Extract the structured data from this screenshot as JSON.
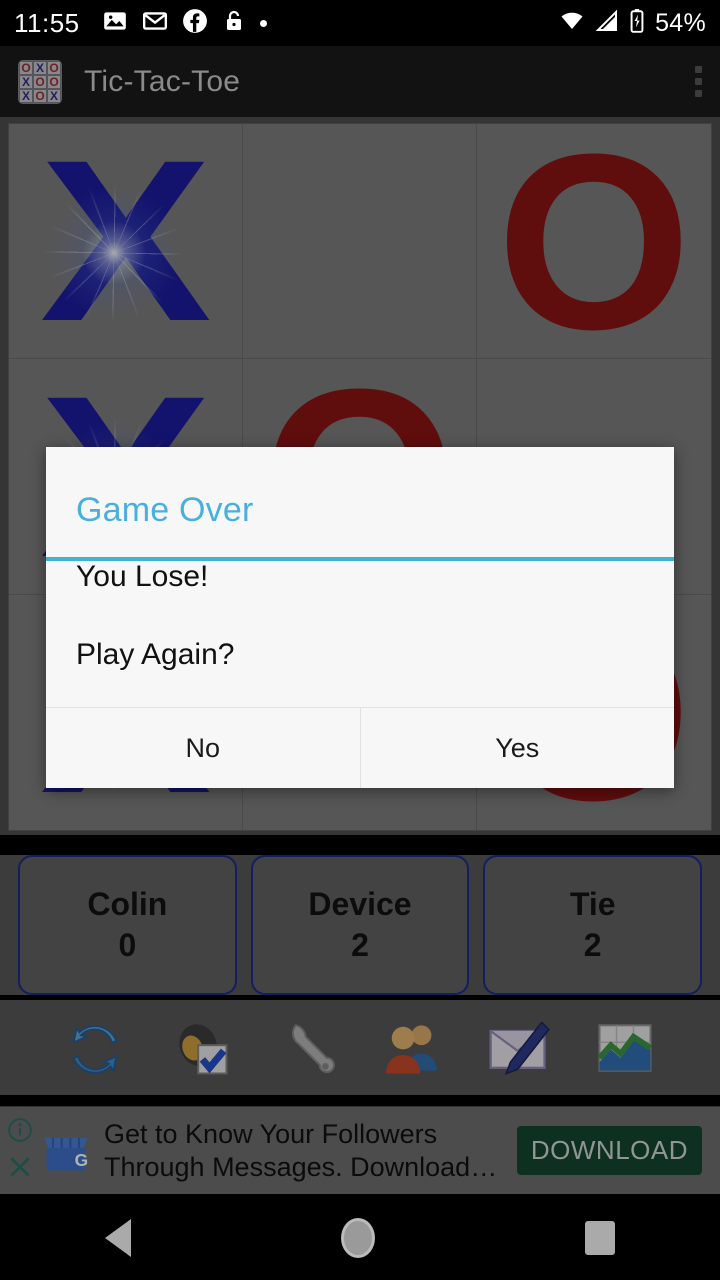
{
  "status_bar": {
    "time": "11:55",
    "battery_percent": "54%",
    "icons_left": [
      "photos-icon",
      "gmail-icon",
      "facebook-icon",
      "unlock-icon",
      "dot-indicator-icon"
    ],
    "icons_right": [
      "wifi-icon",
      "cell-signal-icon",
      "battery-charging-icon"
    ]
  },
  "app_bar": {
    "title": "Tic-Tac-Toe",
    "app_icon": "tic-tac-toe-grid-icon",
    "app_icon_cells": [
      "O",
      "X",
      "O",
      "X",
      "O",
      "O",
      "X",
      "O",
      "X"
    ],
    "overflow_icon": "more-vertical-icon"
  },
  "board": {
    "cells": [
      "X",
      "",
      "O",
      "X",
      "O",
      "",
      "X",
      "",
      "O"
    ],
    "x_color": "#1c1c9c",
    "o_color": "#8a1313",
    "cell_bg": "#7c7c7c",
    "highlight_cells": [
      0,
      3,
      6
    ]
  },
  "scores": [
    {
      "name": "Colin",
      "value": "0"
    },
    {
      "name": "Device",
      "value": "2"
    },
    {
      "name": "Tie",
      "value": "2"
    }
  ],
  "toolbar": {
    "items": [
      {
        "icon": "refresh-restart-icon",
        "label": "New Game"
      },
      {
        "icon": "sound-settings-icon",
        "label": "Sound"
      },
      {
        "icon": "wrench-settings-icon",
        "label": "Settings"
      },
      {
        "icon": "two-players-icon",
        "label": "Players"
      },
      {
        "icon": "email-compose-icon",
        "label": "Feedback"
      },
      {
        "icon": "statistics-chart-icon",
        "label": "Statistics"
      }
    ]
  },
  "ad": {
    "info_icon": "info-circle-icon",
    "close_icon": "close-x-icon",
    "brand_icon": "google-my-business-icon",
    "line1": "Get to Know Your Followers",
    "line2": "Through Messages. Download…",
    "button_label": "DOWNLOAD",
    "button_color": "#14462f"
  },
  "dialog": {
    "title": "Game Over",
    "title_color": "#49b0de",
    "divider_color": "#3cb5d2",
    "message_1": "You Lose!",
    "message_2": "Play Again?",
    "buttons": [
      {
        "label": "No"
      },
      {
        "label": "Yes"
      }
    ]
  },
  "nav_bar": {
    "back": "back-triangle-icon",
    "home": "home-circle-icon",
    "recents": "recents-square-icon"
  }
}
